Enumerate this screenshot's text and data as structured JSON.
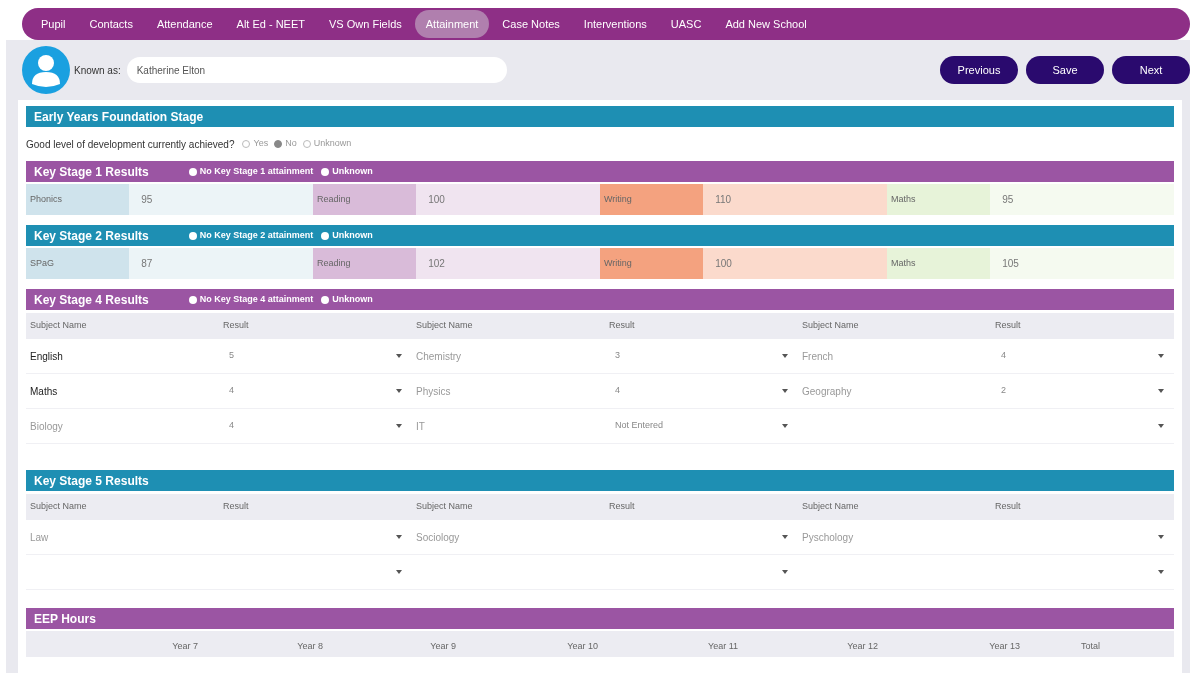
{
  "tabs": [
    {
      "label": "Pupil",
      "selected": false
    },
    {
      "label": "Contacts",
      "selected": false
    },
    {
      "label": "Attendance",
      "selected": false
    },
    {
      "label": "Alt Ed - NEET",
      "selected": false
    },
    {
      "label": "VS Own Fields",
      "selected": false
    },
    {
      "label": "Attainment",
      "selected": true
    },
    {
      "label": "Case Notes",
      "selected": false
    },
    {
      "label": "Interventions",
      "selected": false
    },
    {
      "label": "UASC",
      "selected": false
    },
    {
      "label": "Add New School",
      "selected": false
    }
  ],
  "known_as": {
    "label": "Known as:",
    "value": "Katherine Elton"
  },
  "buttons": [
    "Previous",
    "Save",
    "Next"
  ],
  "eyfs": {
    "title": "Early Years Foundation Stage",
    "question": "Good level of development currently achieved?",
    "options": [
      {
        "label": "Yes",
        "selected": false
      },
      {
        "label": "No",
        "selected": true
      },
      {
        "label": "Unknown",
        "selected": false
      }
    ]
  },
  "score_sections": [
    {
      "title": "Key Stage 1 Results",
      "color": "#9b55a3",
      "options": [
        {
          "label": "No Key Stage 1 attainment",
          "selected": false
        },
        {
          "label": "Unknown",
          "selected": false
        }
      ],
      "scores": [
        {
          "label": "Phonics",
          "value": "95",
          "color": "#cfe3ec"
        },
        {
          "label": "Reading",
          "value": "100",
          "color": "#d9bbd9"
        },
        {
          "label": "Writing",
          "value": "110",
          "color": "#f4a27f"
        },
        {
          "label": "Maths",
          "value": "95",
          "color": "#e7f3d9"
        }
      ]
    },
    {
      "title": "Key Stage 2 Results",
      "color": "#1e8fb3",
      "options": [
        {
          "label": "No Key Stage 2 attainment",
          "selected": false
        },
        {
          "label": "Unknown",
          "selected": false
        }
      ],
      "scores": [
        {
          "label": "SPaG",
          "value": "87",
          "color": "#cfe3ec"
        },
        {
          "label": "Reading",
          "value": "102",
          "color": "#d9bbd9"
        },
        {
          "label": "Writing",
          "value": "100",
          "color": "#f4a27f"
        },
        {
          "label": "Maths",
          "value": "105",
          "color": "#e7f3d9"
        }
      ]
    }
  ],
  "subject_sections": [
    {
      "title": "Key Stage 4 Results",
      "color": "#9b55a3",
      "options": [
        {
          "label": "No Key Stage 4 attainment",
          "selected": false
        },
        {
          "label": "Unknown",
          "selected": false
        }
      ],
      "columns": [
        "Subject Name",
        "Result",
        "Subject Name",
        "Result",
        "Subject Name",
        "Result"
      ],
      "rows": [
        [
          {
            "kind": "fixed",
            "text": "English"
          },
          {
            "kind": "dropdown",
            "text": "5"
          },
          {
            "kind": "entry",
            "text": "Chemistry"
          },
          {
            "kind": "dropdown",
            "text": "3"
          },
          {
            "kind": "entry",
            "text": "French"
          },
          {
            "kind": "dropdown",
            "text": "4"
          }
        ],
        [
          {
            "kind": "fixed",
            "text": "Maths"
          },
          {
            "kind": "dropdown",
            "text": "4"
          },
          {
            "kind": "entry",
            "text": "Physics"
          },
          {
            "kind": "dropdown",
            "text": "4"
          },
          {
            "kind": "entry",
            "text": "Geography"
          },
          {
            "kind": "dropdown",
            "text": "2"
          }
        ],
        [
          {
            "kind": "entry",
            "text": "Biology"
          },
          {
            "kind": "dropdown",
            "text": "4"
          },
          {
            "kind": "entry",
            "text": "IT"
          },
          {
            "kind": "dropdown",
            "text": "Not Entered"
          },
          {
            "kind": "entry",
            "text": ""
          },
          {
            "kind": "dropdown",
            "text": ""
          }
        ]
      ]
    },
    {
      "title": "Key Stage 5 Results",
      "color": "#1e8fb3",
      "columns": [
        "Subject Name",
        "Result",
        "Subject Name",
        "Result",
        "Subject Name",
        "Result"
      ],
      "rows": [
        [
          {
            "kind": "entry",
            "text": "Law"
          },
          {
            "kind": "dropdown",
            "text": ""
          },
          {
            "kind": "entry",
            "text": "Sociology"
          },
          {
            "kind": "dropdown",
            "text": ""
          },
          {
            "kind": "entry",
            "text": "Pyschology"
          },
          {
            "kind": "dropdown",
            "text": ""
          }
        ],
        [
          {
            "kind": "entry",
            "text": ""
          },
          {
            "kind": "dropdown",
            "text": ""
          },
          {
            "kind": "entry",
            "text": ""
          },
          {
            "kind": "dropdown",
            "text": ""
          },
          {
            "kind": "entry",
            "text": ""
          },
          {
            "kind": "dropdown",
            "text": ""
          }
        ]
      ]
    }
  ],
  "eep_hours": {
    "title": "EEP Hours",
    "columns": [
      "Year 7",
      "Year 8",
      "Year 9",
      "Year 10",
      "Year 11",
      "Year 12",
      "Year 13",
      "Total"
    ]
  }
}
